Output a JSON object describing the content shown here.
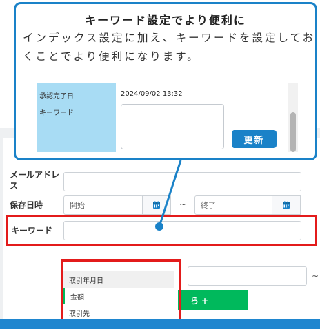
{
  "callout": {
    "title": "キーワード設定でより便利に",
    "body": "インデックス設定に加え、キーワードを設定しておくことでより便利になります。",
    "inset": {
      "approval_label": "承認完了日",
      "keyword_label": "キーワード",
      "approval_date": "2024/09/02 13:32",
      "update_button": "更新"
    }
  },
  "form": {
    "email_label": "メールアドレス",
    "saved_date_label": "保存日時",
    "start_placeholder": "開始",
    "end_placeholder": "終了",
    "range_separator": "~",
    "keyword_label": "キーワード",
    "range_separator_2": "~",
    "green_button_label": "ら +"
  },
  "dropdown": {
    "options": [
      "取引年月日",
      "金額",
      "取引先"
    ]
  },
  "colors": {
    "accent": "#1a82c8",
    "highlight": "#e31b1b",
    "green": "#00b95c",
    "inset_label_bg": "#a8dcf4"
  },
  "icons": [
    "calendar-icon",
    "calendar-icon"
  ]
}
